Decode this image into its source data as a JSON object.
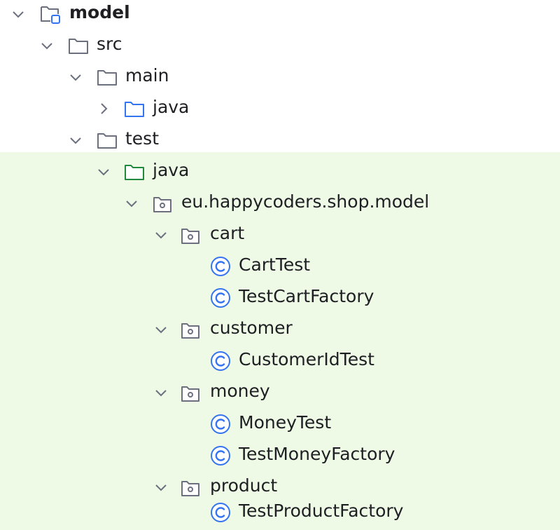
{
  "project_tree": {
    "root": {
      "label": "model",
      "icon": "module-icon",
      "expanded": true
    },
    "src": {
      "label": "src",
      "icon": "folder-icon",
      "expanded": true
    },
    "main": {
      "label": "main",
      "icon": "folder-icon",
      "expanded": true
    },
    "main_java": {
      "label": "java",
      "icon": "source-root-folder-icon",
      "expanded": false
    },
    "test": {
      "label": "test",
      "icon": "folder-icon",
      "expanded": true
    },
    "test_java": {
      "label": "java",
      "icon": "test-root-folder-icon",
      "expanded": true
    },
    "package": {
      "label": "eu.happycoders.shop.model",
      "icon": "package-icon",
      "expanded": true
    },
    "cart": {
      "label": "cart",
      "icon": "package-icon",
      "expanded": true
    },
    "cart_test": {
      "label": "CartTest",
      "icon": "class-icon"
    },
    "test_cart_factory": {
      "label": "TestCartFactory",
      "icon": "class-icon"
    },
    "customer": {
      "label": "customer",
      "icon": "package-icon",
      "expanded": true
    },
    "customer_id_test": {
      "label": "CustomerIdTest",
      "icon": "class-icon"
    },
    "money": {
      "label": "money",
      "icon": "package-icon",
      "expanded": true
    },
    "money_test": {
      "label": "MoneyTest",
      "icon": "class-icon"
    },
    "test_money_factory": {
      "label": "TestMoneyFactory",
      "icon": "class-icon"
    },
    "product": {
      "label": "product",
      "icon": "package-icon",
      "expanded": true
    },
    "test_product_factory": {
      "label": "TestProductFactory",
      "icon": "class-icon"
    }
  },
  "colors": {
    "test_highlight": "#eef9e6",
    "folder_stroke": "#6c707e",
    "source_root_stroke": "#3574f0",
    "test_root_stroke": "#208a3c",
    "class_icon": "#3574f0",
    "text": "#1e1f22"
  }
}
